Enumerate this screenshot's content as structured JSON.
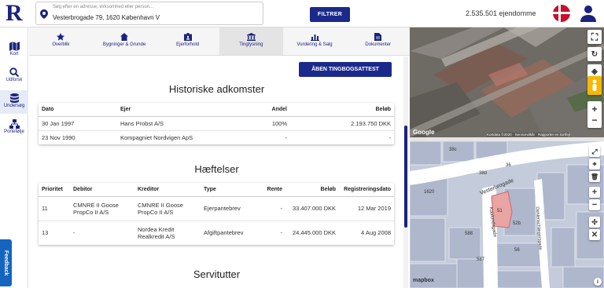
{
  "header": {
    "logo": "R",
    "search_placeholder": "Søg efter en adresse, virksomhed eller person...",
    "search_value": "Vesterbrogade 79, 1620 København V",
    "filter_label": "FILTRER",
    "property_count": "2.535.501 ejendomme"
  },
  "sidebar": {
    "items": [
      {
        "label": "Kort",
        "icon": "map-icon"
      },
      {
        "label": "Udforsk",
        "icon": "explore-icon"
      },
      {
        "label": "Undersøg",
        "icon": "database-icon"
      },
      {
        "label": "Portefølje",
        "icon": "portfolio-icon"
      }
    ],
    "feedback": "Feedback"
  },
  "tabs": [
    {
      "label": "Overblik",
      "icon": "star-icon"
    },
    {
      "label": "Bygninger & Grunde",
      "icon": "home-icon"
    },
    {
      "label": "Ejerforhold",
      "icon": "id-badge-icon"
    },
    {
      "label": "Tinglysning",
      "icon": "bank-icon"
    },
    {
      "label": "Vurdering & Salg",
      "icon": "bar-chart-icon"
    },
    {
      "label": "Dokumenter",
      "icon": "document-icon"
    }
  ],
  "main": {
    "tingbog_button": "ÅBEN TINGBOGSATTEST",
    "adkomster": {
      "title": "Historiske adkomster",
      "headers": [
        "Dato",
        "Ejer",
        "Andel",
        "Beløb"
      ],
      "rows": [
        [
          "30 Jan 1997",
          "Hans Probst A/S",
          "100%",
          "2.193.750 DKK"
        ],
        [
          "23 Nov 1990",
          "Kompagniet Nordvigen ApS",
          "-",
          "-"
        ]
      ]
    },
    "haeftelser": {
      "title": "Hæftelser",
      "headers": [
        "Prioritet",
        "Debitor",
        "Kreditor",
        "Type",
        "Rente",
        "Beløb",
        "Registreringsdato"
      ],
      "rows": [
        [
          "11",
          "CMNRE II Goose PropCo II A/S",
          "CMNRE II Goose PropCo II A/S",
          "Ejerpantebrev",
          "-",
          "33.407.000 DKK",
          "12 Mar 2019"
        ],
        [
          "13",
          "-",
          "Nordea Kredit Realkredit A/S",
          "Afgiftpantebrev",
          "-",
          "24.445.000 DKK",
          "4 Aug 2008"
        ]
      ]
    },
    "servitutter": {
      "title": "Servitutter"
    }
  },
  "map": {
    "aerial_logo": "Google",
    "aerial_attribution": "Kortdata ©2020 · Servicevilkår · Rapporter en kortfejl",
    "vector_logo": "mapbox",
    "street_vesterbrogade": "Vesterbrogade",
    "street_kaalundsgade": "Kaalundsgade",
    "street_oehlenschlaeger": "Oehlenschlægersgade",
    "plot_numbers": [
      "38c",
      "38d",
      "36",
      "1620",
      "51",
      "52b",
      "588",
      "587",
      "56"
    ],
    "colors": {
      "plot": "#aeb7cc",
      "highlight": "#e9a4a4",
      "road": "#ffffff"
    }
  }
}
